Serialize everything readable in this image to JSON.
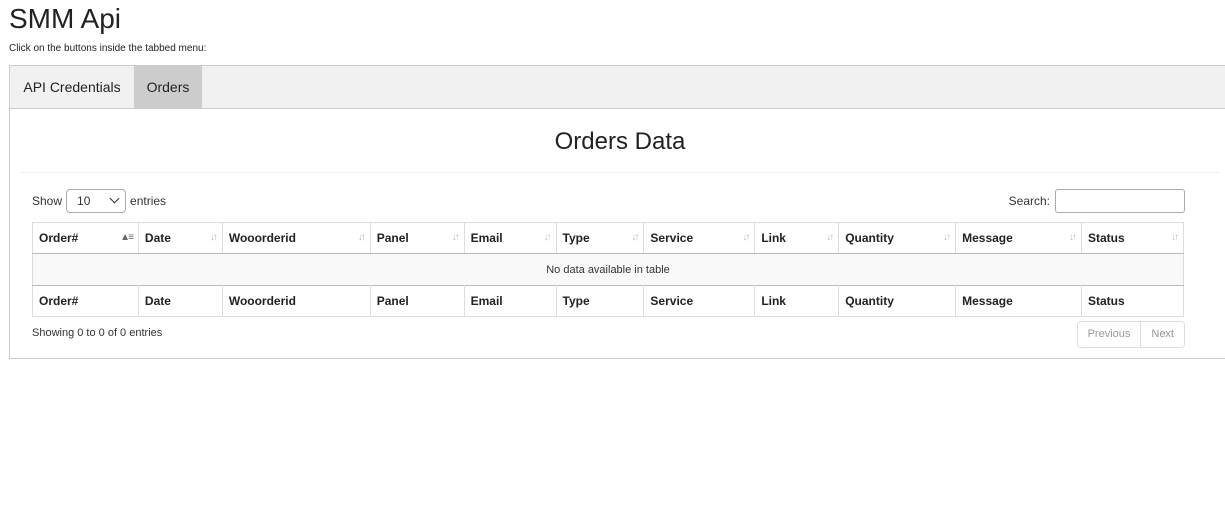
{
  "page": {
    "title": "SMM Api",
    "subtitle": "Click on the buttons inside the tabbed menu:"
  },
  "tabs": [
    {
      "label": "API Credentials",
      "active": false
    },
    {
      "label": "Orders",
      "active": true
    }
  ],
  "orders": {
    "heading": "Orders Data",
    "length": {
      "prefix": "Show",
      "value": "10",
      "suffix": "entries"
    },
    "search": {
      "label": "Search:",
      "value": ""
    },
    "columns": [
      "Order#",
      "Date",
      "Wooorderid",
      "Panel",
      "Email",
      "Type",
      "Service",
      "Link",
      "Quantity",
      "Message",
      "Status"
    ],
    "empty_message": "No data available in table",
    "info": "Showing 0 to 0 of 0 entries",
    "pagination": {
      "previous": "Previous",
      "next": "Next"
    }
  },
  "colors": {
    "tab_active_bg": "#cccccc",
    "tab_bar_bg": "#f1f1f1"
  }
}
